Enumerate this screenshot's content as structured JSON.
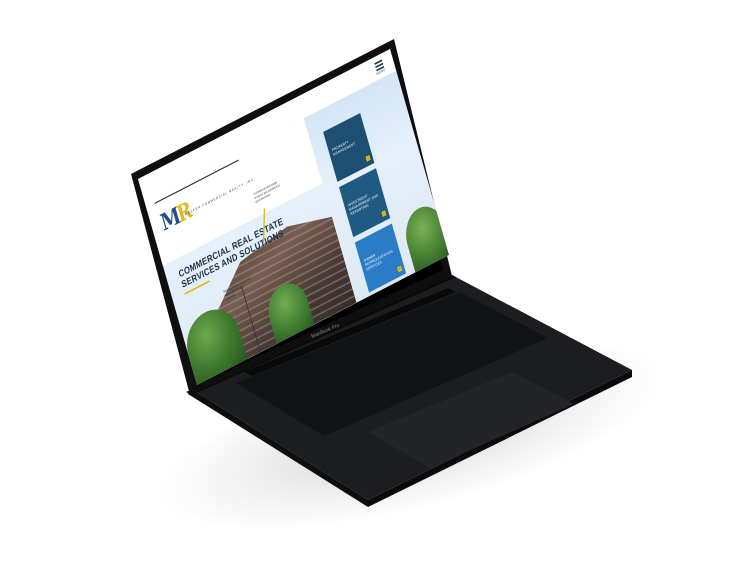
{
  "laptop": {
    "model_label": "MacBook Pro"
  },
  "site": {
    "menu": {
      "label": "MENU"
    },
    "logo": {
      "letter1": "M",
      "letter2": "R",
      "subtitle": "WESKER COMMERCIAL REALTY, INC."
    },
    "hero": {
      "title": "COMMERCIAL REAL ESTATE SERVICES AND SOLUTIONS",
      "note_top": "Commercial real estate services and solutions to grow business",
      "note_bottom": "Serving clients across the region with trusted expertise"
    },
    "services": [
      {
        "label": "PROPERTY MANAGEMENT"
      },
      {
        "label": "INVESTMENT MANAGEMENT AND REPORTING"
      },
      {
        "label": "OWNER REPRESENTATION SERVICES"
      }
    ]
  },
  "colors": {
    "navy": "#1e3550",
    "gold": "#e2b820",
    "card_dark": "#1d4f73",
    "card_blue": "#2a7cc4",
    "laptop_body": "#1b1c1e"
  }
}
